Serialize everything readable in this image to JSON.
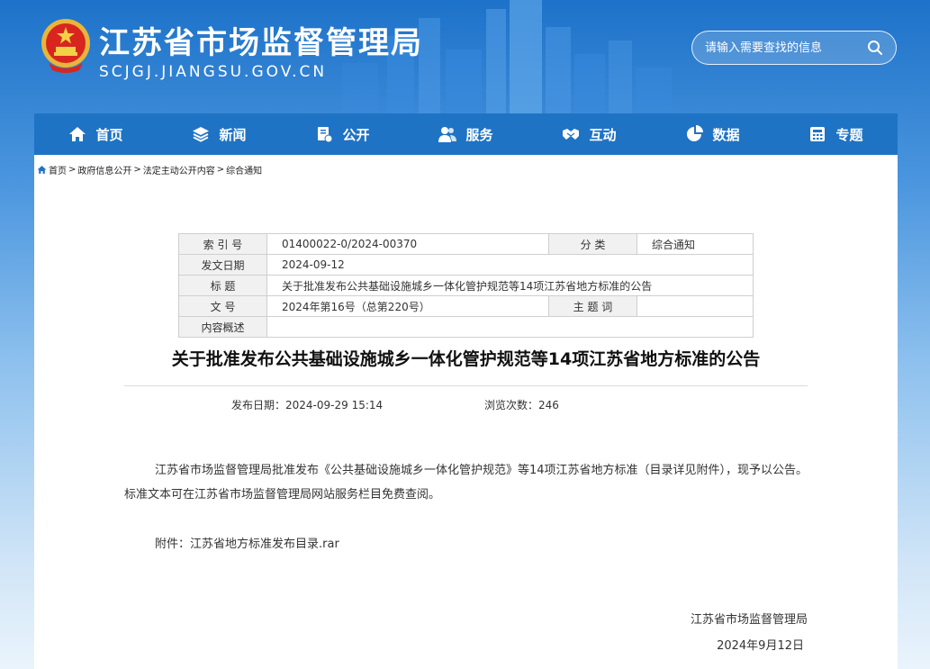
{
  "header": {
    "site_name": "江苏省市场监督管理局",
    "site_domain": "SCJGJ.JIANGSU.GOV.CN",
    "search_placeholder": "请输入需要查找的信息"
  },
  "nav": {
    "items": [
      {
        "label": "首页",
        "icon": "home-icon"
      },
      {
        "label": "新闻",
        "icon": "layers-icon"
      },
      {
        "label": "公开",
        "icon": "open-icon"
      },
      {
        "label": "服务",
        "icon": "people-icon"
      },
      {
        "label": "互动",
        "icon": "handshake-icon"
      },
      {
        "label": "数据",
        "icon": "pie-chart-icon"
      },
      {
        "label": "专题",
        "icon": "calculator-icon"
      }
    ]
  },
  "breadcrumb": [
    "首页",
    "政府信息公开",
    "法定主动公开内容",
    "综合通知"
  ],
  "meta": {
    "index_label": "索 引 号",
    "index_value": "01400022-0/2024-00370",
    "category_label": "分 类",
    "category_value": "综合通知",
    "date_label": "发文日期",
    "date_value": "2024-09-12",
    "title_label": "标 题",
    "title_value": "关于批准发布公共基础设施城乡一体化管护规范等14项江苏省地方标准的公告",
    "doc_no_label": "文 号",
    "doc_no_value": "2024年第16号（总第220号）",
    "topic_label": "主 题 词",
    "topic_value": "",
    "summary_label": "内容概述",
    "summary_value": ""
  },
  "article": {
    "title": "关于批准发布公共基础设施城乡一体化管护规范等14项江苏省地方标准的公告",
    "publish_label": "发布日期：",
    "publish_date": "2024-09-29 15:14",
    "views_label": "浏览次数：",
    "views": "246",
    "para1": "江苏省市场监督管理局批准发布《公共基础设施城乡一体化管护规范》等14项江苏省地方标准（目录详见附件），现予以公告。",
    "para2": "标准文本可在江苏省市场监督管理局网站服务栏目免费查阅。",
    "attach_label": "附件：",
    "attach_file": "江苏省地方标准发布目录.rar",
    "sign_org": "江苏省市场监督管理局",
    "sign_date": "2024年9月12日"
  },
  "colors": {
    "nav_bg": "#1f73c4",
    "header_bg": "#1d72c9"
  }
}
